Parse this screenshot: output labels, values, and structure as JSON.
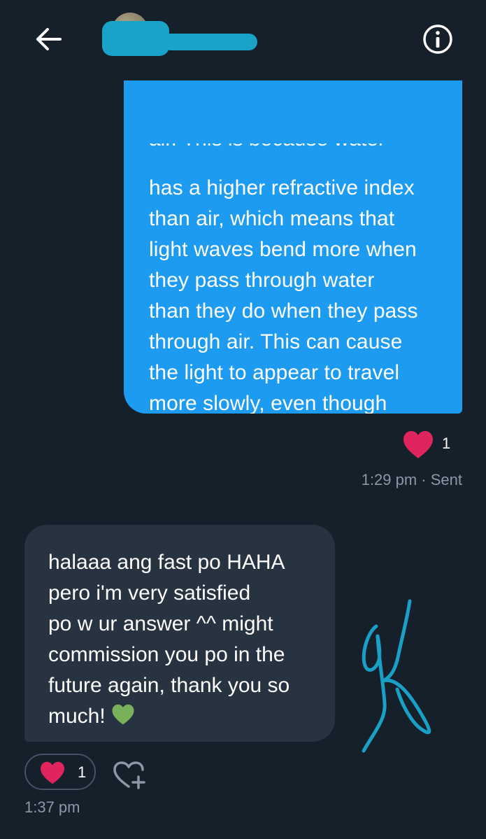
{
  "header": {
    "back_icon": "arrow-left-icon",
    "info_icon": "info-icon",
    "redaction_color": "#1aa3c8"
  },
  "messages": [
    {
      "direction": "sent",
      "clipped_line": "air. This is because water",
      "text": "has a higher refractive index\nthan air, which means that\nlight waves bend more when\nthey pass through water\nthan they do when they pass\nthrough air. This can cause\nthe light to appear to travel\nmore slowly, even though\nit is actually moving at the\nsame speed.",
      "reaction_count": "1",
      "meta": "1:29 pm · Sent",
      "bubble_color": "#1d9bf0"
    },
    {
      "direction": "received",
      "text": "halaaa ang fast po HAHA\npero i'm very satisfied\npo w ur answer ^^ might\ncommission you po in the\nfuture again, thank you so\nmuch!",
      "emoji": "green-heart-icon",
      "reaction_count": "1",
      "meta": "1:37 pm",
      "bubble_color": "#273340"
    }
  ],
  "colors": {
    "background": "#15202b",
    "heart_red": "#e0245e",
    "heart_green": "#78b159",
    "muted_text": "#8b98a5",
    "signature": "#1a9fc6"
  }
}
